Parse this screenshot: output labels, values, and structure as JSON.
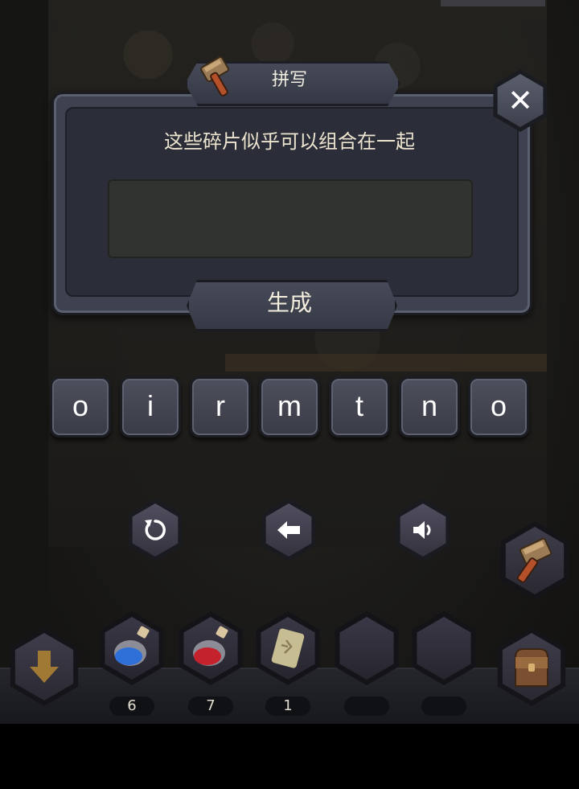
{
  "dialog": {
    "title": "拼写",
    "prompt": "这些碎片似乎可以组合在一起",
    "answer": "",
    "generate_label": "生成"
  },
  "letters": [
    "o",
    "i",
    "r",
    "m",
    "t",
    "n",
    "o"
  ],
  "controls": {
    "close_icon": "close-icon",
    "reset_icon": "refresh-icon",
    "backspace_icon": "arrow-left-icon",
    "sound_icon": "speaker-icon",
    "craft_icon": "hammer-icon"
  },
  "inventory": {
    "collapse_icon": "arrow-down-icon",
    "bag_icon": "backpack-icon",
    "items": [
      {
        "icon": "blue-potion-icon",
        "count": "6"
      },
      {
        "icon": "red-potion-icon",
        "count": "7"
      },
      {
        "icon": "rune-stone-icon",
        "count": "1"
      },
      {
        "icon": "",
        "count": ""
      },
      {
        "icon": "",
        "count": ""
      }
    ]
  },
  "colors": {
    "panel": "#3d4150",
    "answer_box": "#30332f",
    "text_light": "#ece4cf",
    "blue_potion": "#2f6fd8",
    "red_potion": "#c4232d"
  }
}
